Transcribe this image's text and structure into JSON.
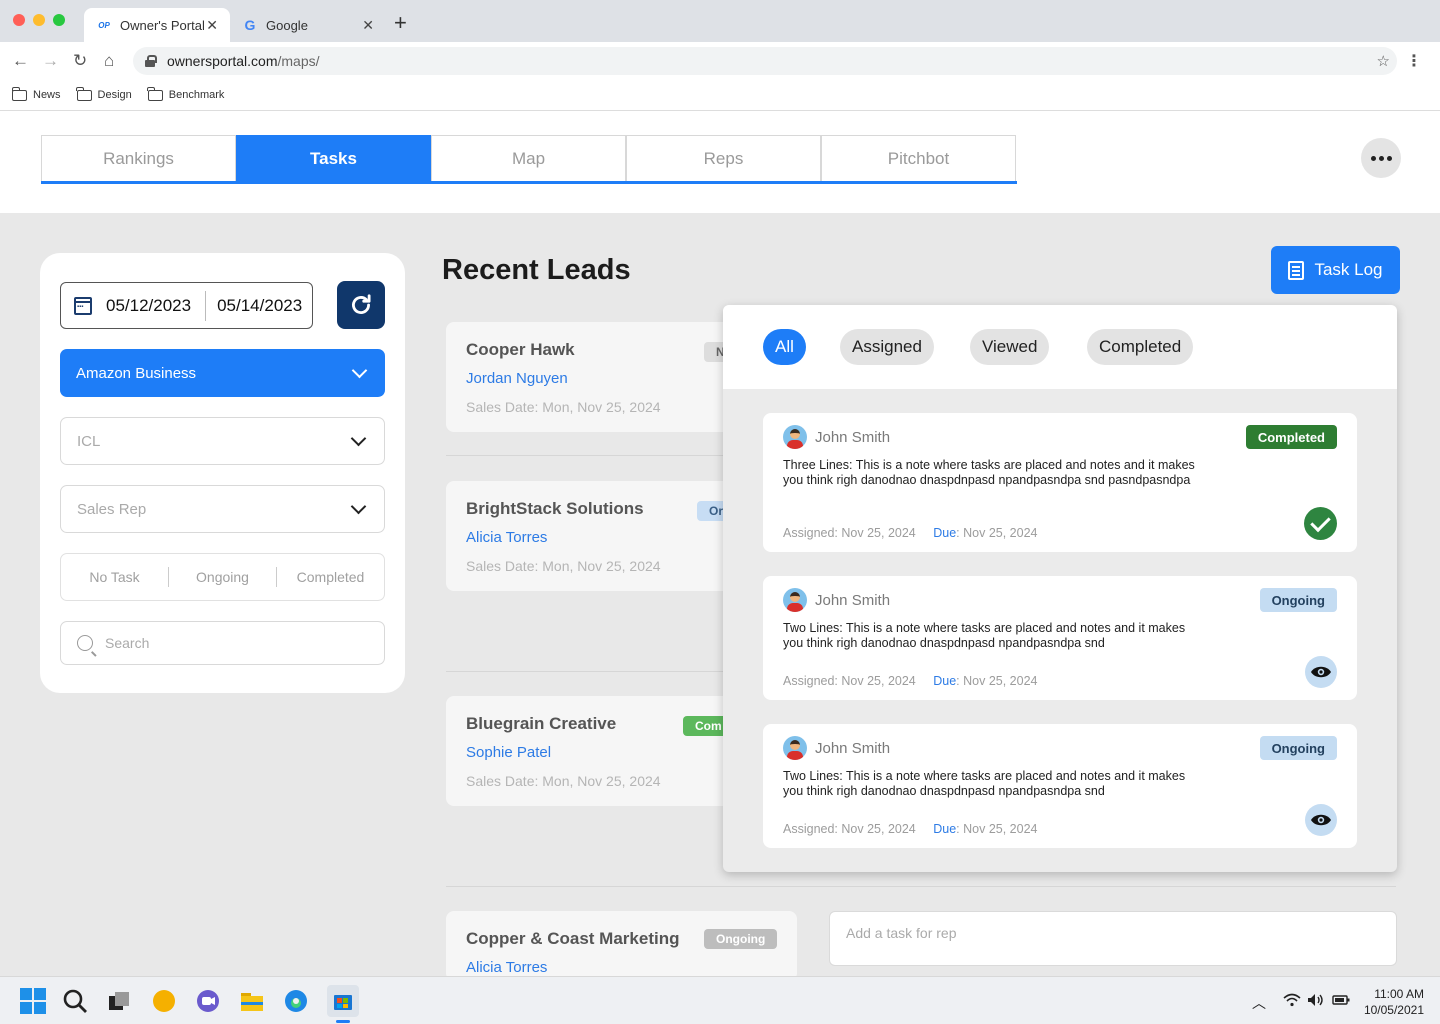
{
  "browser": {
    "tabs": [
      {
        "label": "Owner's Portal",
        "favicon": "OP",
        "close": "✕"
      },
      {
        "label": "Google",
        "favicon": "G",
        "close": "✕"
      }
    ],
    "new_tab": "+",
    "url_host": "ownersportal.com",
    "url_path": "/maps/",
    "bookmarks": [
      "News",
      "Design",
      "Benchmark"
    ]
  },
  "nav": {
    "tabs": [
      "Rankings",
      "Tasks",
      "Map",
      "Reps",
      "Pitchbot"
    ],
    "active": "Tasks"
  },
  "filters": {
    "date_start": "05/12/2023",
    "date_end": "05/14/2023",
    "business": "Amazon Business",
    "icl_placeholder": "ICL",
    "rep_placeholder": "Sales Rep",
    "status_options": [
      "No Task",
      "Ongoing",
      "Completed"
    ],
    "search_placeholder": "Search"
  },
  "main": {
    "title": "Recent Leads",
    "task_log_label": "Task Log",
    "task_input_placeholder": "Add a task for rep"
  },
  "leads": [
    {
      "name": "Cooper Hawk",
      "rep": "Jordan Nguyen",
      "date": "Sales Date: Mon, Nov 25, 2024",
      "badge": "N"
    },
    {
      "name": "BrightStack Solutions",
      "rep": "Alicia Torres",
      "date": "Sales Date: Mon, Nov 25, 2024",
      "badge": "Or"
    },
    {
      "name": "Bluegrain Creative",
      "rep": "Sophie Patel",
      "date": "Sales Date: Mon, Nov 25, 2024",
      "badge": "Com"
    },
    {
      "name": "Copper & Coast Marketing",
      "rep": "Alicia Torres",
      "date": "",
      "badge": "Ongoing"
    }
  ],
  "task_log": {
    "filters": [
      "All",
      "Assigned",
      "Viewed",
      "Completed"
    ],
    "active_filter": "All",
    "tasks": [
      {
        "assignee": "John Smith",
        "status": "Completed",
        "note": "Three Lines: This is a note where tasks are placed and notes and it makes you think righ danodnao dnaspdnpasd npandpasndpa snd pasndpasndpa",
        "assigned_label": "Assigned:",
        "assigned": "Nov 25, 2024",
        "due_label": "Due",
        "due": "Nov 25, 2024",
        "action_icon": "check-icon"
      },
      {
        "assignee": "John Smith",
        "status": "Ongoing",
        "note": "Two Lines: This is a note where tasks are placed and notes and it makes you think righ danodnao dnaspdnpasd npandpasndpa snd",
        "assigned_label": "Assigned:",
        "assigned": "Nov 25, 2024",
        "due_label": "Due",
        "due": "Nov 25, 2024",
        "action_icon": "eye-icon"
      },
      {
        "assignee": "John Smith",
        "status": "Ongoing",
        "note": "Two Lines: This is a note where tasks are placed and notes and it makes you think righ danodnao dnaspdnpasd npandpasndpa snd",
        "assigned_label": "Assigned:",
        "assigned": "Nov 25, 2024",
        "due_label": "Due",
        "due": "Nov 25, 2024",
        "action_icon": "eye-icon"
      }
    ]
  },
  "taskbar": {
    "time": "11:00 AM",
    "date": "10/05/2021"
  },
  "colors": {
    "accent": "#1e7df7",
    "navy": "#10376b",
    "completed": "#2e7d32",
    "ongoing_bg": "#c4dcf2",
    "link": "#2d7be5"
  }
}
